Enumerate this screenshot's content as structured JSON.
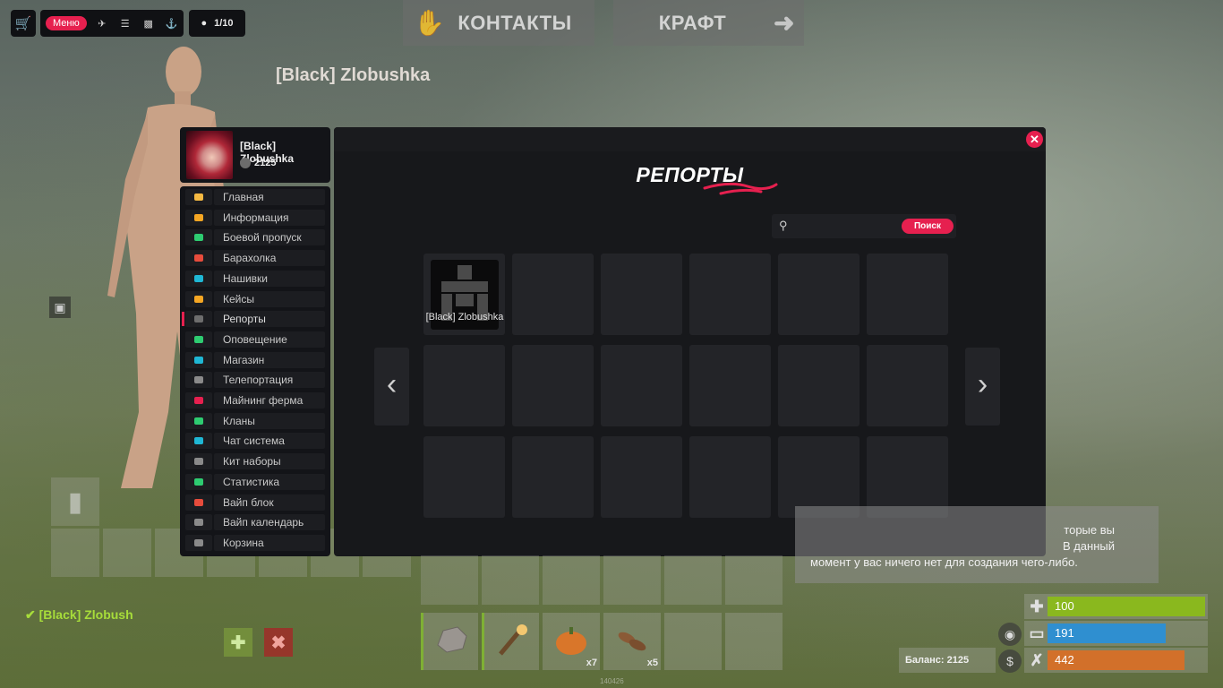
{
  "toolbar": {
    "basket_icon": "basket-icon",
    "menu_label": "Меню",
    "menu_icons": [
      "plane-icon",
      "helicopter-icon",
      "vehicle-icon",
      "boat-icon"
    ],
    "players_count": "1/10"
  },
  "top_tabs": {
    "contacts": "КОНТАКТЫ",
    "craft": "КРАФТ"
  },
  "player_title": "[Black] Zlobushka",
  "profile": {
    "name": "[Black] Zlobushka",
    "balance": "2125"
  },
  "sidebar": {
    "items": [
      {
        "label": "Главная",
        "color": "#f5b942"
      },
      {
        "label": "Информация",
        "color": "#f5a623"
      },
      {
        "label": "Боевой пропуск",
        "color": "#2ecc71"
      },
      {
        "label": "Барахолка",
        "color": "#e74c3c"
      },
      {
        "label": "Нашивки",
        "color": "#1fb7d4"
      },
      {
        "label": "Кейсы",
        "color": "#f5a623"
      },
      {
        "label": "Репорты",
        "color": "#6d6d6d"
      },
      {
        "label": "Оповещение",
        "color": "#2ecc71"
      },
      {
        "label": "Магазин",
        "color": "#1fb7d4"
      },
      {
        "label": "Телепортация",
        "color": "#8a8a8a"
      },
      {
        "label": "Майнинг ферма",
        "color": "#e6204f"
      },
      {
        "label": "Кланы",
        "color": "#2ecc71"
      },
      {
        "label": "Чат система",
        "color": "#1fb7d4"
      },
      {
        "label": "Кит наборы",
        "color": "#8a8a8a"
      },
      {
        "label": "Статистика",
        "color": "#2ecc71"
      },
      {
        "label": "Вайп блок",
        "color": "#e74c3c"
      },
      {
        "label": "Вайп календарь",
        "color": "#8a8a8a"
      },
      {
        "label": "Корзина",
        "color": "#8a8a8a"
      }
    ],
    "active_index": 6
  },
  "panel": {
    "title": "РЕПОРТЫ",
    "search_placeholder": "",
    "search_button": "Поиск",
    "reports": [
      {
        "name": "[Black] Zlobushka"
      }
    ]
  },
  "crafting_message": {
    "line1": "торые вы",
    "line2": "В данный",
    "line3": "момент у вас ничего нет для создания чего-либо."
  },
  "team": {
    "member_name": "[Black] Zlobush"
  },
  "belt": {
    "items": [
      {
        "name": "stone-item",
        "qty": ""
      },
      {
        "name": "torch-item",
        "qty": ""
      },
      {
        "name": "pumpkin-item",
        "qty": "x7"
      },
      {
        "name": "seeds-item",
        "qty": "x5"
      }
    ],
    "tiny_label": "140426"
  },
  "stats": {
    "health": {
      "value": "100",
      "fill": 1.0,
      "color": "#8ab81e"
    },
    "water": {
      "value": "191",
      "fill": 0.75,
      "color": "#2f8fd0"
    },
    "food": {
      "value": "442",
      "fill": 0.87,
      "color": "#d2702a"
    },
    "balance_label": "Баланс: 2125"
  },
  "colors": {
    "accent": "#e6204f"
  }
}
